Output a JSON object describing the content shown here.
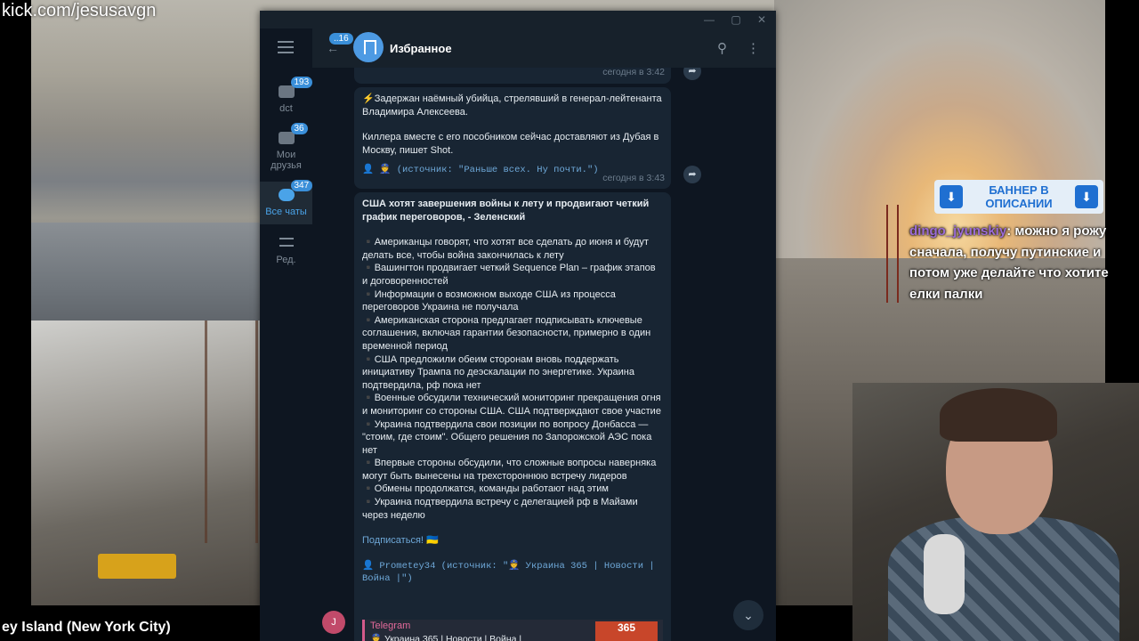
{
  "stream": {
    "watermark": "kick.com/jesusavgn",
    "location": "ey Island (New York City)"
  },
  "telegram": {
    "window_controls": {
      "minimize": "—",
      "maximize": "▢",
      "close": "✕"
    },
    "folders": [
      {
        "label": "dct",
        "badge": "193"
      },
      {
        "label": "Мои друзья",
        "badge": "36"
      },
      {
        "label": "Все чаты",
        "badge": "347"
      },
      {
        "label": "Ред.",
        "badge": ""
      }
    ],
    "header": {
      "back_badge": "..16",
      "title": "Избранное"
    },
    "messages": [
      {
        "time": "сегодня в 3:42"
      },
      {
        "text1": "⚡️Задержан наёмный убийца, стрелявший в генерал-лейтенанта Владимира Алексеева.",
        "text2": "Киллера вместе с его пособником сейчас доставляют из Дубая в Москву, пишет Shot.",
        "source": "👤 👮 (источник: \"Раньше всех. Ну почти.\")",
        "time": "сегодня в 3:43"
      },
      {
        "title": "США хотят завершения войны к лету и продвигают четкий график переговоров, - Зеленский",
        "bullets": [
          "▪️Американцы говорят, что хотят все сделать до июня и будут делать все, чтобы война закончилась к лету",
          "▪️Вашингтон продвигает четкий Sequence Plan – график этапов и договоренностей",
          "▪️Информации о возможном выходе США из процесса переговоров Украина не получала",
          "▪️Американская сторона предлагает подписывать ключевые соглашения, включая гарантии безопасности, примерно в один временной период",
          "▪️США предложили обеим сторонам вновь поддержать инициативу Трампа по деэскалации по энергетике. Украина подтвердила, рф пока нет",
          "▪️Военные обсудили технический мониторинг прекращения огня и мониторинг со стороны США. США подтверждают свое участие",
          "▪️Украина подтвердила свои позиции по вопросу Донбасса — \"стоим, где стоим\". Общего решения по Запорожской АЭС пока нет",
          "▪️Впервые стороны обсудили, что сложные вопросы наверняка могут быть вынесены на трехстороннюю встречу лидеров",
          "▪️Обмены продолжатся, команды работают над этим",
          "▪️Украина подтвердила встречу с делегацией рф в Майами через неделю"
        ],
        "subscribe": "Подписаться! 🇺🇦",
        "source": "👤 Prometey34 (источник: \"👮 Украина 365 | Новости | Война |\")",
        "preview_title": "Telegram",
        "preview_body": "👮 Украина 365 | Новости | Война |",
        "preview_img": "365"
      }
    ],
    "user_initial": "J"
  },
  "overlay": {
    "banner_text": "БАННЕР В ОПИСАНИИ",
    "chat_nick": "dingo_jyunskiy",
    "chat_message": ": можно я рожу сначала, получу путинские и потом уже делайте что хотите елки палки"
  }
}
